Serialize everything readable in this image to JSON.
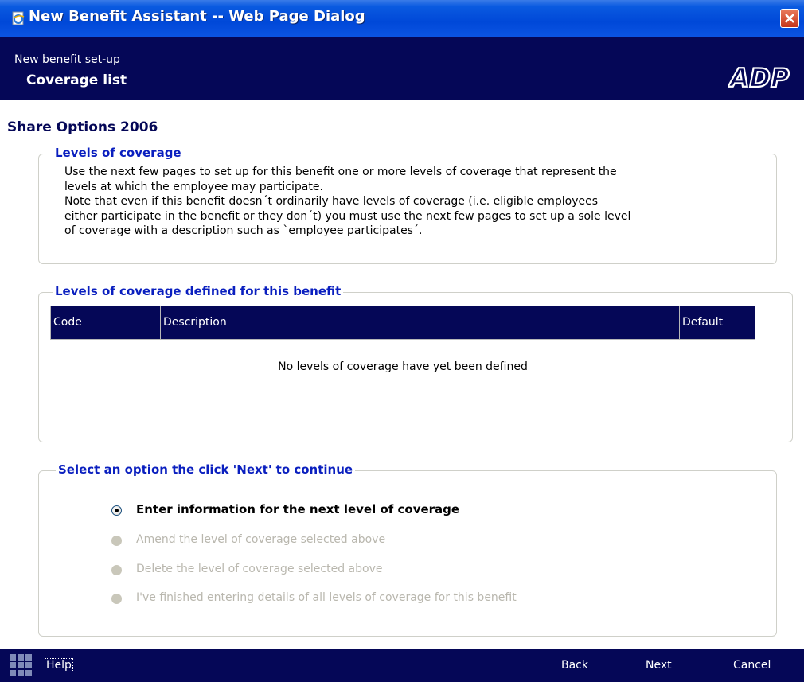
{
  "window": {
    "title": "New Benefit Assistant -- Web Page Dialog"
  },
  "header": {
    "subtitle": "New benefit set-up",
    "title": "Coverage list",
    "logo_text": "ADP"
  },
  "page_title": "Share Options 2006",
  "levels_section": {
    "legend": "Levels of coverage",
    "lines": [
      "Use the next few pages to set up for this benefit one or more levels of coverage that represent the",
      "levels at which the employee may participate.",
      "Note that even if this benefit doesn´t ordinarily have levels of coverage (i.e. eligible employees",
      "either participate in the benefit or they don´t) you must use the next few pages to set up a sole level",
      "of coverage with a description such as `employee participates´."
    ]
  },
  "defined_section": {
    "legend": "Levels of coverage defined for this benefit",
    "columns": [
      "Code",
      "Description",
      "Default"
    ],
    "rows": [],
    "empty_message": "No levels of coverage have yet been defined"
  },
  "options_section": {
    "legend": "Select an option the click 'Next' to continue",
    "options": [
      {
        "label": "Enter information for the next level of coverage",
        "selected": true,
        "enabled": true
      },
      {
        "label": "Amend the level of coverage selected above",
        "selected": false,
        "enabled": false
      },
      {
        "label": "Delete the level of coverage selected above",
        "selected": false,
        "enabled": false
      },
      {
        "label": "I've finished entering details of all levels of coverage for this benefit",
        "selected": false,
        "enabled": false
      }
    ]
  },
  "footer": {
    "help_label": "Help",
    "back_label": "Back",
    "next_label": "Next",
    "cancel_label": "Cancel"
  },
  "colors": {
    "header_bg": "#050757",
    "legend_text": "#0a1fbf",
    "disabled_text": "#b9b7ae",
    "titlebar": "#0048d8"
  },
  "icons": [
    "ie-page-icon",
    "close-icon",
    "adp-logo",
    "grid-menu-icon",
    "radio-selected-icon",
    "radio-disabled-icon"
  ]
}
